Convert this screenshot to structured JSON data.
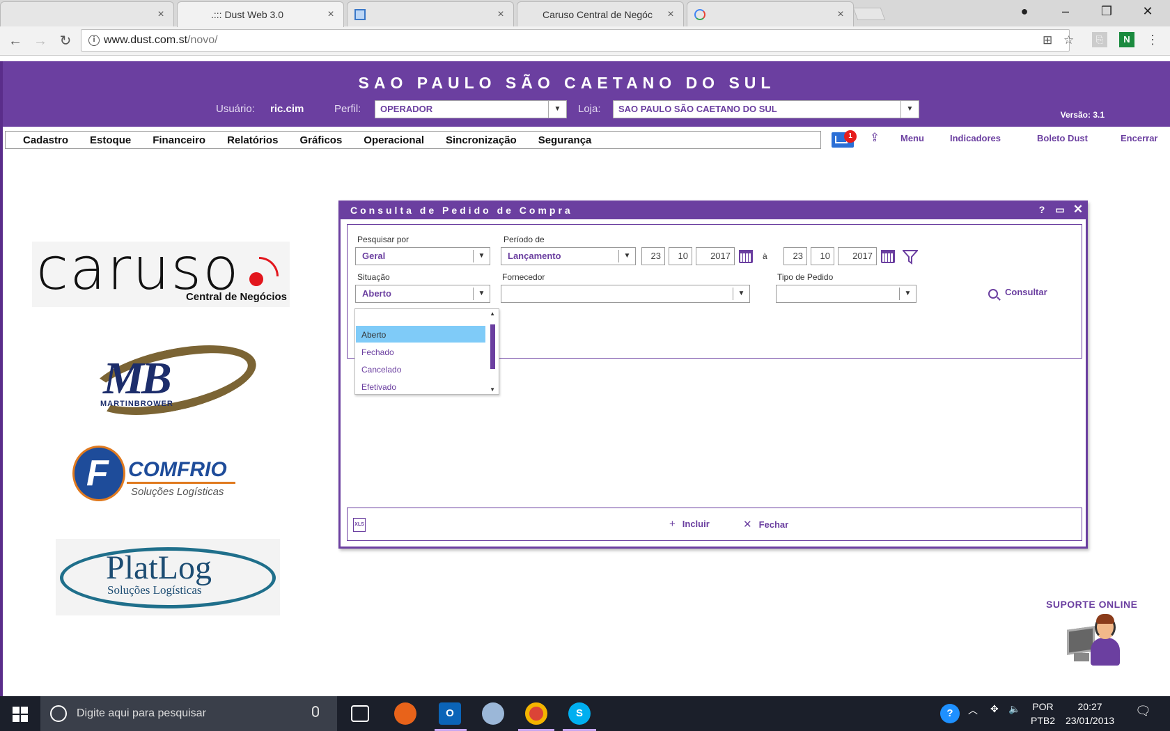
{
  "browser": {
    "tabs": [
      {
        "title": "",
        "active": false
      },
      {
        "title": ".::: Dust Web 3.0",
        "active": true
      },
      {
        "title": "",
        "active": false
      },
      {
        "title": "Caruso Central de Negóc",
        "active": false
      },
      {
        "title": "",
        "active": false
      }
    ],
    "url_host": "www.dust.com.st",
    "url_path": "/novo/",
    "extension_n": "N"
  },
  "header": {
    "title": "SAO PAULO SÃO CAETANO DO SUL",
    "usuario_label": "Usuário:",
    "usuario_value": "ric.cim",
    "perfil_label": "Perfil:",
    "perfil_value": "OPERADOR",
    "loja_label": "Loja:",
    "loja_value": "SAO PAULO SÃO CAETANO DO SUL",
    "version": "Versão: 3.1",
    "accent_color": "#6b3fa0"
  },
  "menu": {
    "items": [
      "Cadastro",
      "Estoque",
      "Financeiro",
      "Relatórios",
      "Gráficos",
      "Operacional",
      "Sincronização",
      "Segurança"
    ],
    "mail_badge": "1",
    "links": [
      "Menu",
      "Indicadores",
      "Boleto Dust",
      "Encerrar"
    ]
  },
  "logos": {
    "caruso_word": "caruso",
    "caruso_sub": "Central de Negócios",
    "mb_word": "MB",
    "mb_sub": "MARTINBROWER",
    "comfrio_word": "COMFRIO",
    "comfrio_sub": "Soluções Logísticas",
    "platlog_word": "PlatLog",
    "platlog_sub": "Soluções Logísticas"
  },
  "dialog": {
    "title": "Consulta de Pedido de Compra",
    "help": "?",
    "pesquisar_label": "Pesquisar por",
    "pesquisar_value": "Geral",
    "periodo_label": "Período de",
    "periodo_value": "Lançamento",
    "date_from": {
      "day": "23",
      "month": "10",
      "year": "2017"
    },
    "date_sep": "à",
    "date_to": {
      "day": "23",
      "month": "10",
      "year": "2017"
    },
    "situacao_label": "Situação",
    "situacao_value": "Aberto",
    "fornecedor_label": "Fornecedor",
    "fornecedor_value": "",
    "tipo_label": "Tipo de Pedido",
    "tipo_value": "",
    "consultar": "Consultar",
    "incluir": "Incluir",
    "fechar": "Fechar",
    "xls": "XLS",
    "situacao_options": [
      "Aberto",
      "Fechado",
      "Cancelado",
      "Efetivado"
    ],
    "situacao_selected": "Aberto"
  },
  "suporte": "SUPORTE ONLINE",
  "taskbar": {
    "search_placeholder": "Digite aqui para pesquisar",
    "lang_line1": "POR",
    "lang_line2": "PTB2",
    "time": "20:27",
    "date": "23/01/2013"
  }
}
